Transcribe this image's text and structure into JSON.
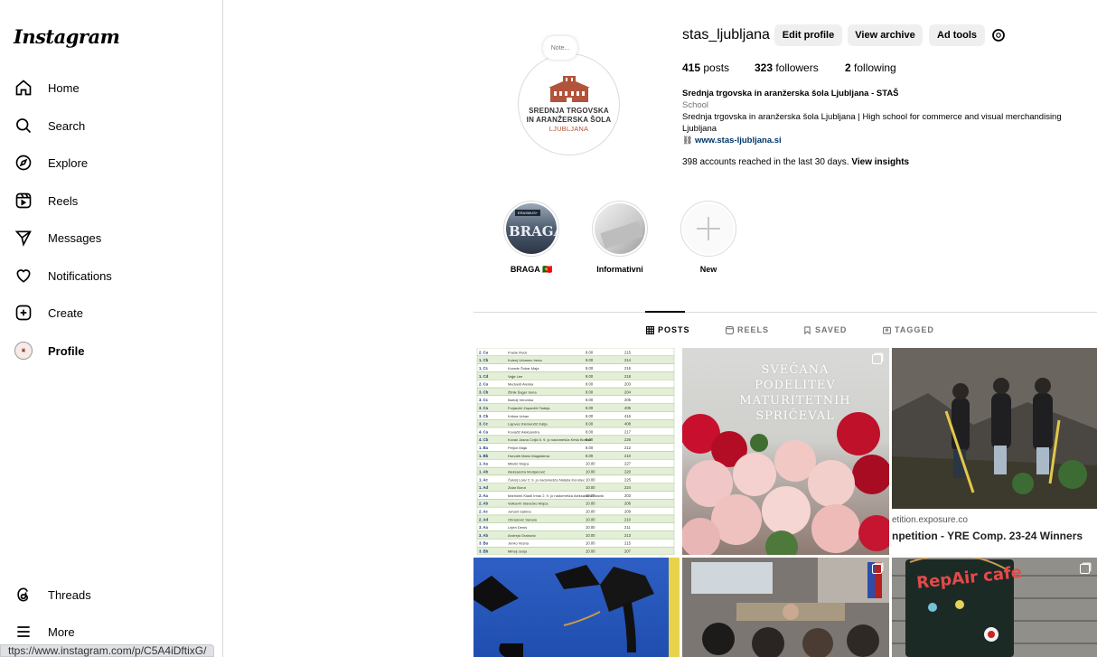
{
  "app": {
    "logo": "Instagram"
  },
  "sidebar": {
    "items": [
      {
        "label": "Home",
        "icon": "home-icon"
      },
      {
        "label": "Search",
        "icon": "search-icon"
      },
      {
        "label": "Explore",
        "icon": "compass-icon"
      },
      {
        "label": "Reels",
        "icon": "reels-icon"
      },
      {
        "label": "Messages",
        "icon": "paper-plane-icon"
      },
      {
        "label": "Notifications",
        "icon": "heart-icon"
      },
      {
        "label": "Create",
        "icon": "plus-square-icon"
      },
      {
        "label": "Profile",
        "icon": "avatar"
      }
    ],
    "threads": "Threads",
    "more": "More"
  },
  "status_url": "ttps://www.instagram.com/p/C5A4iDftixG/",
  "profile": {
    "note": "Note...",
    "picture_text": [
      "SREDNJA TRGOVSKA",
      "IN ARANŽERSKA ŠOLA",
      "LJUBLJANA"
    ],
    "username": "stas_ljubljana",
    "buttons": {
      "edit": "Edit profile",
      "archive": "View archive",
      "ad_tools": "Ad tools"
    },
    "stats": {
      "posts_count": "415",
      "posts_label": "posts",
      "followers_count": "323",
      "followers_label": "followers",
      "following_count": "2",
      "following_label": "following"
    },
    "bio": {
      "name": "Srednja trgovska in aranžerska šola Ljubljana - STAŠ",
      "category": "School",
      "line1": "Srednja trgovska in aranžerska šola Ljubljana | High school for commerce and visual merchandising",
      "line2": "Ljubljana",
      "link": "www.stas-ljubljana.si"
    },
    "insights_text": "398 accounts reached in the last 30 days.",
    "insights_link": "View insights"
  },
  "highlights": [
    {
      "label": "BRAGA 🇵🇹",
      "badge": "ERASMUS+",
      "word": "BRAGA"
    },
    {
      "label": "Informativni"
    },
    {
      "label": "New"
    }
  ],
  "tabs": [
    {
      "label": "POSTS",
      "active": true
    },
    {
      "label": "REELS"
    },
    {
      "label": "SAVED"
    },
    {
      "label": "TAGGED"
    }
  ],
  "posts": {
    "p2_title": [
      "SVEČANA",
      "PODELITEV",
      "MATURITETNIH",
      "SPRIČEVAL"
    ],
    "p3_domain": "etition.exposure.co",
    "p3_title": "npetition - YRE Comp. 23-24 Winners",
    "p6_text": "RepAir cafe"
  },
  "table_rows": [
    [
      "2. Ca",
      "Frasle Rock",
      "8.00",
      "215"
    ],
    [
      "1. Cb",
      "Kolenj Urbanec Irena",
      "8.00",
      "214"
    ],
    [
      "1. Cc",
      "Korade Šobar Maja",
      "8.00",
      "216"
    ],
    [
      "1. Cd",
      "Vajje Lee",
      "8.00",
      "218"
    ],
    [
      "2. Ca",
      "Medvedi Alenka",
      "8.00",
      "203"
    ],
    [
      "3. Cb",
      "Žitnik Šager Irena",
      "8.00",
      "204"
    ],
    [
      "3. Cc",
      "Bartolj Veronika",
      "8.00",
      "205"
    ],
    [
      "3. Ca",
      "Forjančič Zupančič Tadeja",
      "8.00",
      "405"
    ],
    [
      "3. Cb",
      "Krišna Urban",
      "8.00",
      "416"
    ],
    [
      "3. Cc",
      "Lajovec Klemenčič Katja",
      "8.00",
      "408"
    ],
    [
      "4. Ca",
      "Kovačič Aleksandra",
      "8.00",
      "217"
    ],
    [
      "4. Cb",
      "Kovač Jasna Cvijić 5. 9. jo nadomešča Ketla Bosnar",
      "8.00",
      "226"
    ],
    [
      "1. Ba",
      "Peljon Maja",
      "8.00",
      "212"
    ],
    [
      "1. Bb",
      "Horvath Mario Magdalena",
      "8.00",
      "210"
    ],
    [
      "1. Aa",
      "Milutić Mojca",
      "10.00",
      "227"
    ],
    [
      "1. Ab",
      "Aleksandra Modjanović",
      "10.00",
      "220"
    ],
    [
      "1. Ac",
      "Čeksij Lola/ 2. 9. jo nadomešča Nataša Korošec",
      "10.00",
      "225"
    ],
    [
      "1. Ad",
      "Zidar Borut",
      "10.00",
      "224"
    ],
    [
      "2. Aa",
      "Marinček Kladil Irina/ 2. 9. jo nadomešča Aleksandra Hosnik",
      "10.00",
      "203"
    ],
    [
      "2. Ab",
      "Velkavrh Slavečko Mojca",
      "10.00",
      "206"
    ],
    [
      "2. Ac",
      "Juhant Sabina",
      "10.00",
      "209"
    ],
    [
      "2. Ad",
      "Obradović Sanela",
      "10.00",
      "210"
    ],
    [
      "3. Aa",
      "Lejen Denis",
      "10.00",
      "211"
    ],
    [
      "3. Ab",
      "Andreja Grabovic",
      "10.00",
      "213"
    ],
    [
      "3. Ba",
      "Jenko Vesna",
      "10.00",
      "215"
    ],
    [
      "3. Bb",
      "Mihelj Janja",
      "10.00",
      "207"
    ]
  ]
}
